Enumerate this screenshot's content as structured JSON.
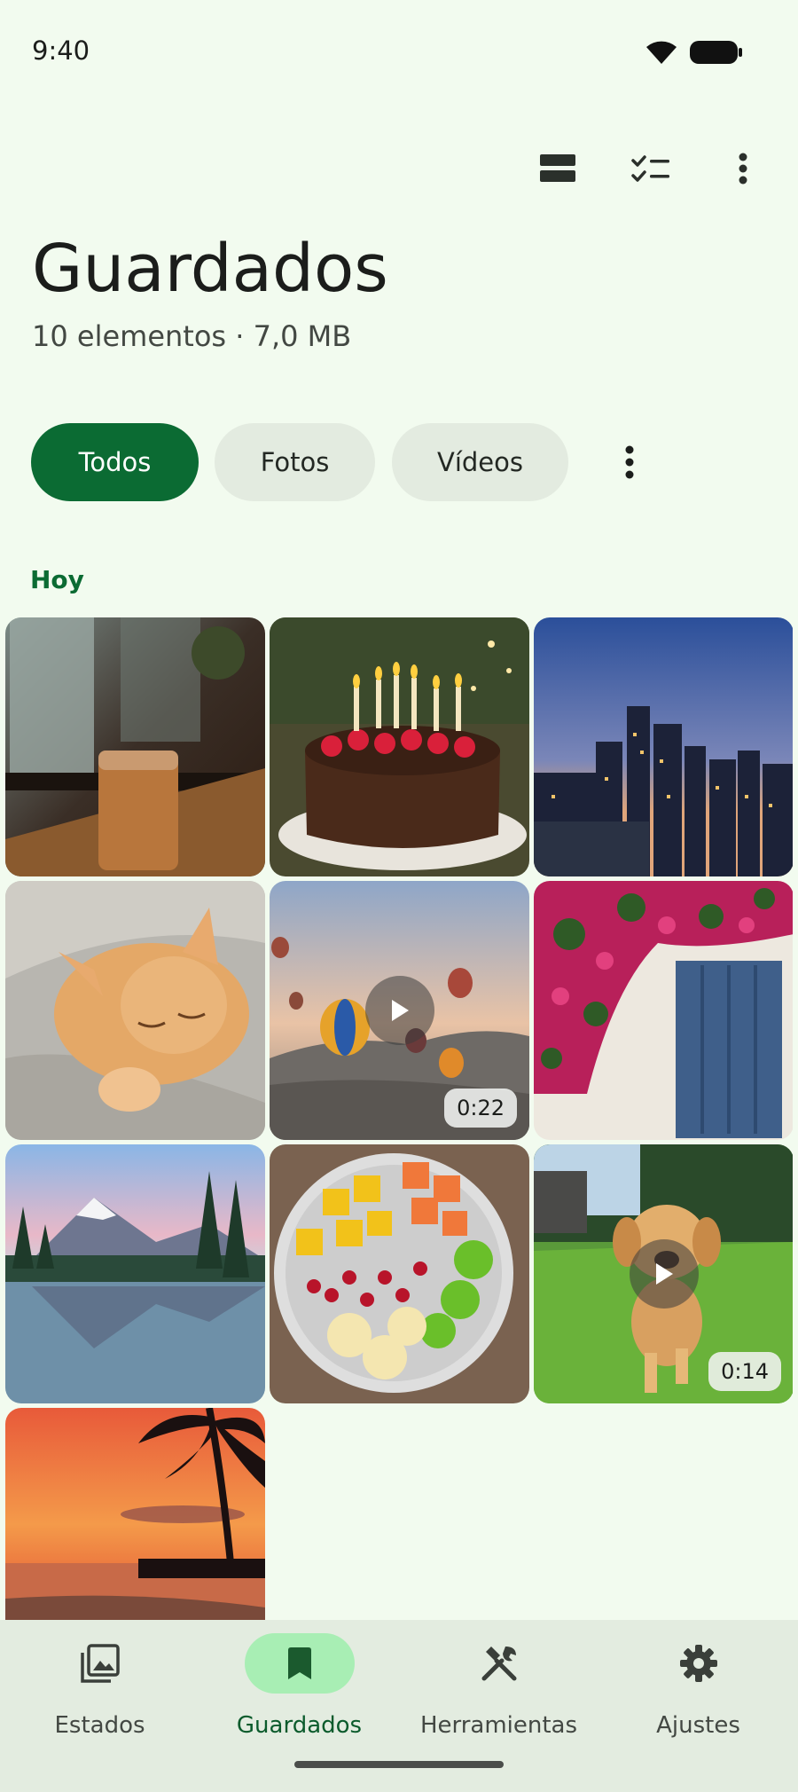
{
  "status_bar": {
    "time": "9:40"
  },
  "header": {
    "title": "Guardados",
    "subtitle": "10 elementos · 7,0 MB"
  },
  "top_actions": [
    {
      "icon": "view-stream-icon"
    },
    {
      "icon": "checklist-icon"
    },
    {
      "icon": "more-vert-icon"
    }
  ],
  "filters": {
    "chips": [
      {
        "label": "Todos",
        "active": true
      },
      {
        "label": "Fotos",
        "active": false
      },
      {
        "label": "Vídeos",
        "active": false
      }
    ]
  },
  "section": {
    "label": "Hoy"
  },
  "media": [
    {
      "subject": "coffee-window",
      "type": "photo"
    },
    {
      "subject": "birthday-cake",
      "type": "photo"
    },
    {
      "subject": "city-night",
      "type": "photo"
    },
    {
      "subject": "sleeping-kitten",
      "type": "photo"
    },
    {
      "subject": "hot-air-balloons",
      "type": "video",
      "duration": "0:22"
    },
    {
      "subject": "flowers-blue-door",
      "type": "photo"
    },
    {
      "subject": "mountain-lake",
      "type": "photo"
    },
    {
      "subject": "fruit-bowl",
      "type": "photo"
    },
    {
      "subject": "puppy-running",
      "type": "video",
      "duration": "0:14"
    },
    {
      "subject": "beach-sunset",
      "type": "photo"
    }
  ],
  "bottom_nav": {
    "items": [
      {
        "label": "Estados",
        "icon": "photo-library-icon",
        "active": false
      },
      {
        "label": "Guardados",
        "icon": "bookmark-icon",
        "active": true
      },
      {
        "label": "Herramientas",
        "icon": "tools-icon",
        "active": false
      },
      {
        "label": "Ajustes",
        "icon": "settings-gear-icon",
        "active": false
      }
    ]
  },
  "colors": {
    "background": "#f2fbef",
    "accent": "#0b6b33",
    "nav_active_pill": "#a8eeb4"
  }
}
